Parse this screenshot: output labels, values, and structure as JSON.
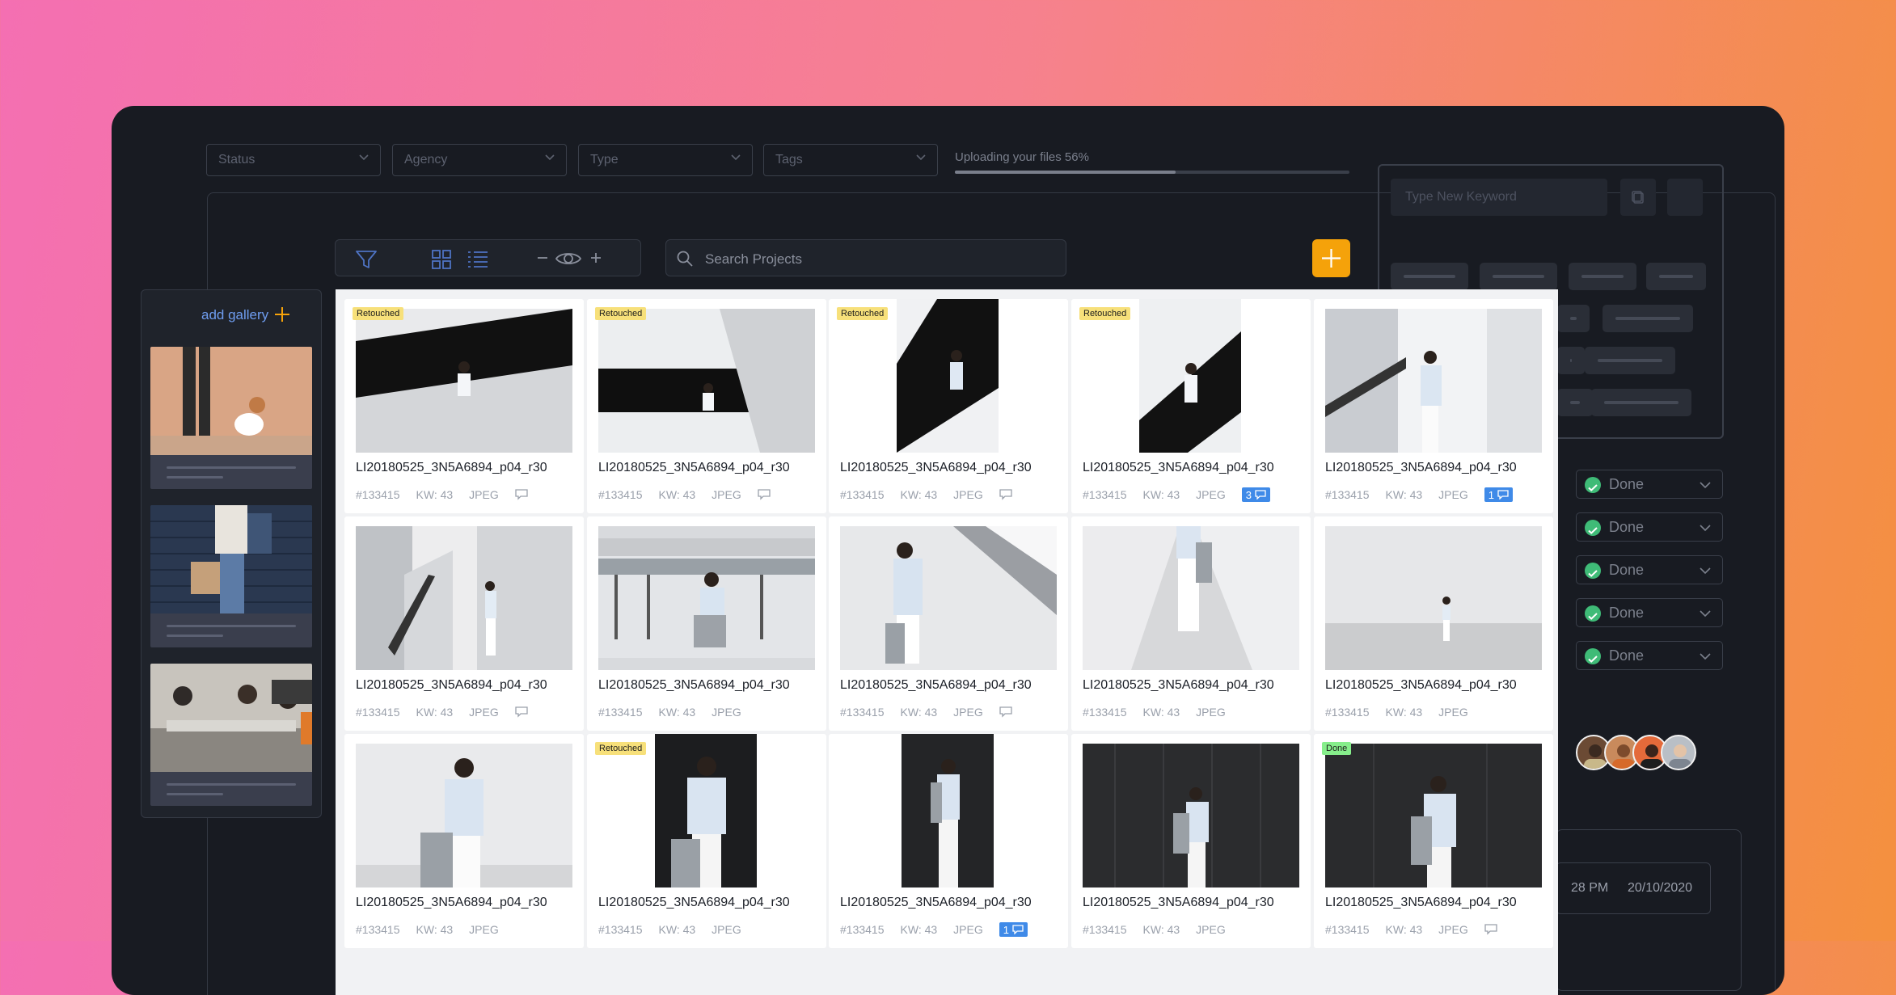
{
  "filters": [
    {
      "label": "Status"
    },
    {
      "label": "Agency"
    },
    {
      "label": "Type"
    },
    {
      "label": "Tags"
    }
  ],
  "upload": {
    "label": "Uploading your files 56%",
    "progress": 0.56
  },
  "search": {
    "placeholder": "Search Projects"
  },
  "keyword_panel": {
    "placeholder": "Type  New Keyword"
  },
  "sidebar": {
    "add_gallery_label": "add gallery"
  },
  "status_column": [
    {
      "label": "Done"
    },
    {
      "label": "Done"
    },
    {
      "label": "Done"
    },
    {
      "label": "Done"
    },
    {
      "label": "Done"
    }
  ],
  "datetime": {
    "time": "28 PM",
    "date": "20/10/2020"
  },
  "colors": {
    "accent": "#f5a20a",
    "done": "#3fbb77",
    "comment_badge": "#3f8ae8",
    "retouched": "#f7e07a",
    "done_badge": "#86ee8b"
  },
  "icons": [
    "filter-icon",
    "grid-view-icon",
    "list-view-icon",
    "zoom-out-icon",
    "eye-icon",
    "zoom-in-icon",
    "search-icon",
    "plus-icon",
    "copy-icon",
    "check-icon",
    "chevron-down-icon",
    "comment-icon"
  ],
  "assets": [
    {
      "badge": "Retouched",
      "filename": "LI20180525_3N5A6894_p04_r30",
      "id": "#133415",
      "kw": "KW: 43",
      "format": "JPEG",
      "comments": "",
      "comment_icon": true
    },
    {
      "badge": "Retouched",
      "filename": "LI20180525_3N5A6894_p04_r30",
      "id": "#133415",
      "kw": "KW: 43",
      "format": "JPEG",
      "comments": "",
      "comment_icon": true
    },
    {
      "badge": "Retouched",
      "filename": "LI20180525_3N5A6894_p04_r30",
      "id": "#133415",
      "kw": "KW: 43",
      "format": "JPEG",
      "comments": "",
      "comment_icon": true
    },
    {
      "badge": "Retouched",
      "filename": "LI20180525_3N5A6894_p04_r30",
      "id": "#133415",
      "kw": "KW: 43",
      "format": "JPEG",
      "comments": "3",
      "comment_icon": true
    },
    {
      "badge": "",
      "filename": "LI20180525_3N5A6894_p04_r30",
      "id": "#133415",
      "kw": "KW: 43",
      "format": "JPEG",
      "comments": "1",
      "comment_icon": true
    },
    {
      "badge": "",
      "filename": "LI20180525_3N5A6894_p04_r30",
      "id": "#133415",
      "kw": "KW: 43",
      "format": "JPEG",
      "comments": "",
      "comment_icon": true
    },
    {
      "badge": "",
      "filename": "LI20180525_3N5A6894_p04_r30",
      "id": "#133415",
      "kw": "KW: 43",
      "format": "JPEG",
      "comments": "",
      "comment_icon": false
    },
    {
      "badge": "",
      "filename": "LI20180525_3N5A6894_p04_r30",
      "id": "#133415",
      "kw": "KW: 43",
      "format": "JPEG",
      "comments": "",
      "comment_icon": true
    },
    {
      "badge": "",
      "filename": "LI20180525_3N5A6894_p04_r30",
      "id": "#133415",
      "kw": "KW: 43",
      "format": "JPEG",
      "comments": "",
      "comment_icon": false
    },
    {
      "badge": "",
      "filename": "LI20180525_3N5A6894_p04_r30",
      "id": "#133415",
      "kw": "KW: 43",
      "format": "JPEG",
      "comments": "",
      "comment_icon": false
    },
    {
      "badge": "",
      "filename": "LI20180525_3N5A6894_p04_r30",
      "id": "#133415",
      "kw": "KW: 43",
      "format": "JPEG",
      "comments": "",
      "comment_icon": false
    },
    {
      "badge": "Retouched",
      "filename": "LI20180525_3N5A6894_p04_r30",
      "id": "#133415",
      "kw": "KW: 43",
      "format": "JPEG",
      "comments": "",
      "comment_icon": false
    },
    {
      "badge": "",
      "filename": "LI20180525_3N5A6894_p04_r30",
      "id": "#133415",
      "kw": "KW: 43",
      "format": "JPEG",
      "comments": "1",
      "comment_icon": true
    },
    {
      "badge": "",
      "filename": "LI20180525_3N5A6894_p04_r30",
      "id": "#133415",
      "kw": "KW: 43",
      "format": "JPEG",
      "comments": "",
      "comment_icon": false
    },
    {
      "badge": "Done",
      "filename": "LI20180525_3N5A6894_p04_r30",
      "id": "#133415",
      "kw": "KW: 43",
      "format": "JPEG",
      "comments": "",
      "comment_icon": true
    }
  ]
}
